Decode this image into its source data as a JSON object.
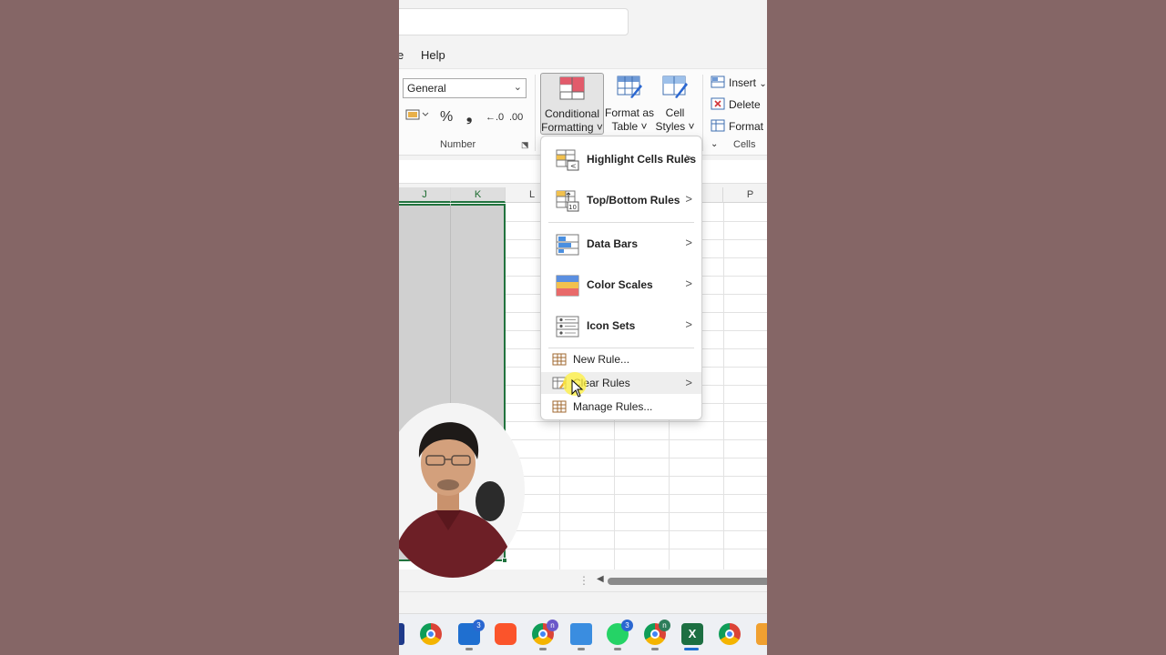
{
  "menubar": {
    "partial_item": "e",
    "help": "Help"
  },
  "ribbon": {
    "number_format": "General",
    "number_buttons": {
      "percent": "%",
      "comma": "❟",
      "increase_decimal": "←.0",
      "decrease_decimal": ".00"
    },
    "number_group_label": "Number",
    "conditional_formatting": {
      "line1": "Conditional",
      "line2": "Formatting ˅"
    },
    "format_as_table": {
      "line1": "Format as",
      "line2": "Table ˅"
    },
    "cell_styles": {
      "line1": "Cell",
      "line2": "Styles ˅"
    },
    "insert": "Insert",
    "delete": "Delete",
    "format": "Format",
    "cells_group_label": "Cells"
  },
  "grid": {
    "columns": [
      "J",
      "K",
      "L",
      "P"
    ]
  },
  "cf_menu": {
    "items": [
      {
        "label": "Highlight Cells Rules",
        "submenu": true
      },
      {
        "label": "Top/Bottom Rules",
        "submenu": true
      },
      {
        "label": "Data Bars",
        "submenu": true
      },
      {
        "label": "Color Scales",
        "submenu": true
      },
      {
        "label": "Icon Sets",
        "submenu": true
      },
      {
        "label": "New Rule...",
        "submenu": false
      },
      {
        "label": "Clear Rules",
        "submenu": true
      },
      {
        "label": "Manage Rules...",
        "submenu": false
      }
    ],
    "chevron": ">"
  },
  "taskbar": {
    "badges": {
      "mail": "3",
      "chrome_profile": "n",
      "whatsapp": "3",
      "chrome_profile_2": "n"
    },
    "icons": [
      "app-icon",
      "chrome-icon",
      "mail-icon",
      "brave-icon",
      "chrome-profile-icon",
      "notepad-icon",
      "whatsapp-icon",
      "chrome-profile-2-icon",
      "excel-icon",
      "chrome-icon",
      "app-orange-icon"
    ]
  },
  "colors": {
    "excel_green": "#21733e",
    "background": "#856666",
    "selection": "#d0d0d0"
  }
}
